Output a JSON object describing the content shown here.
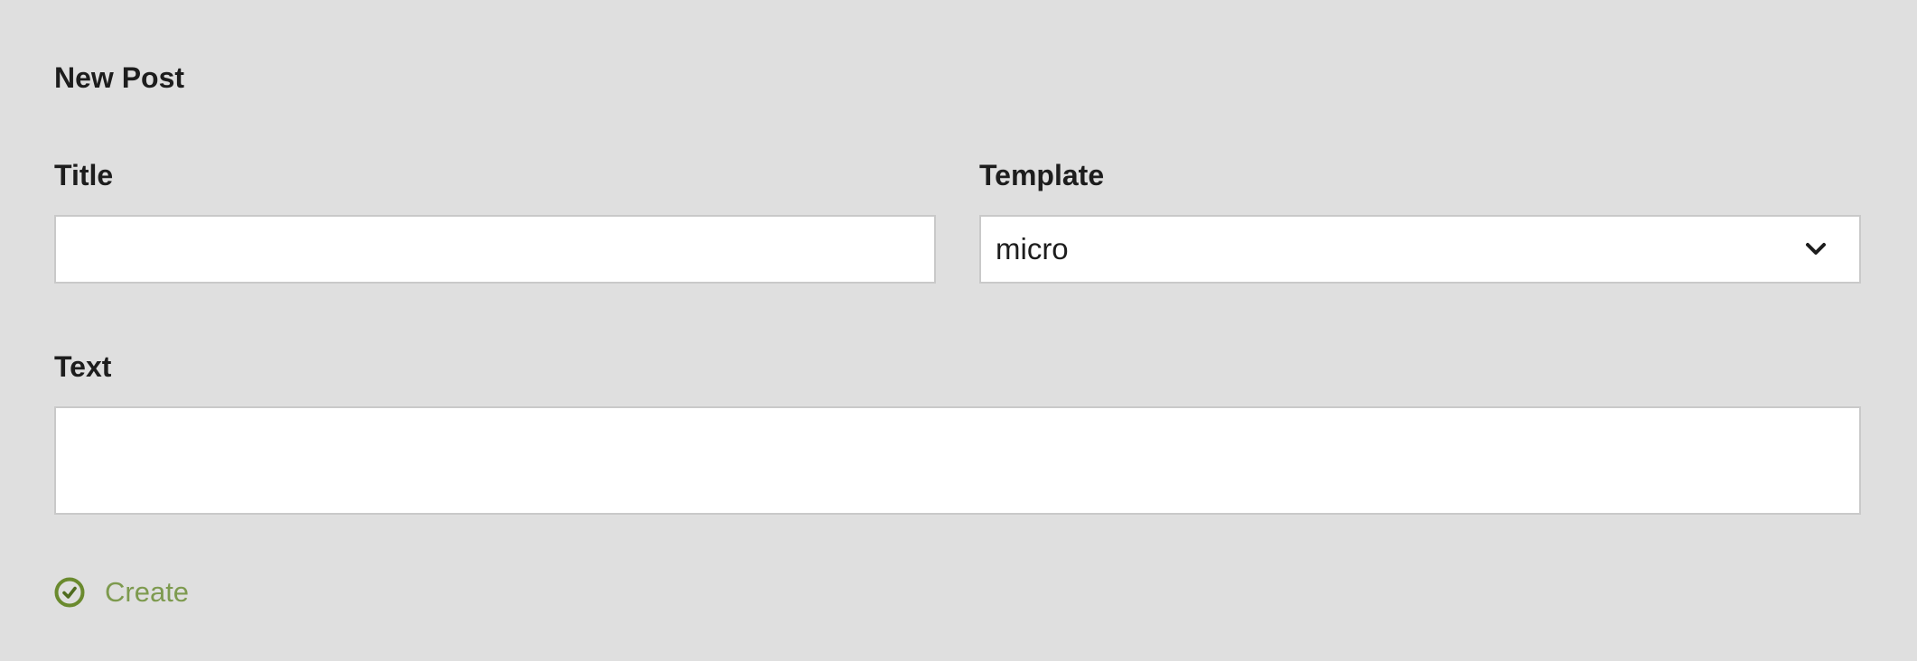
{
  "form": {
    "heading": "New Post",
    "fields": {
      "title": {
        "label": "Title",
        "value": "",
        "placeholder": ""
      },
      "template": {
        "label": "Template",
        "selected": "micro",
        "icon": "chevron-down-icon"
      },
      "text": {
        "label": "Text",
        "value": "",
        "placeholder": ""
      }
    },
    "create_button": {
      "label": "Create",
      "icon": "check-circle-icon"
    }
  },
  "colors": {
    "background": "#dfdfdf",
    "input_background": "#ffffff",
    "input_border": "#c9c9c9",
    "text": "#1d1d1d",
    "accent_icon": "#6a8a2e",
    "accent_text": "#7d9a4e"
  }
}
